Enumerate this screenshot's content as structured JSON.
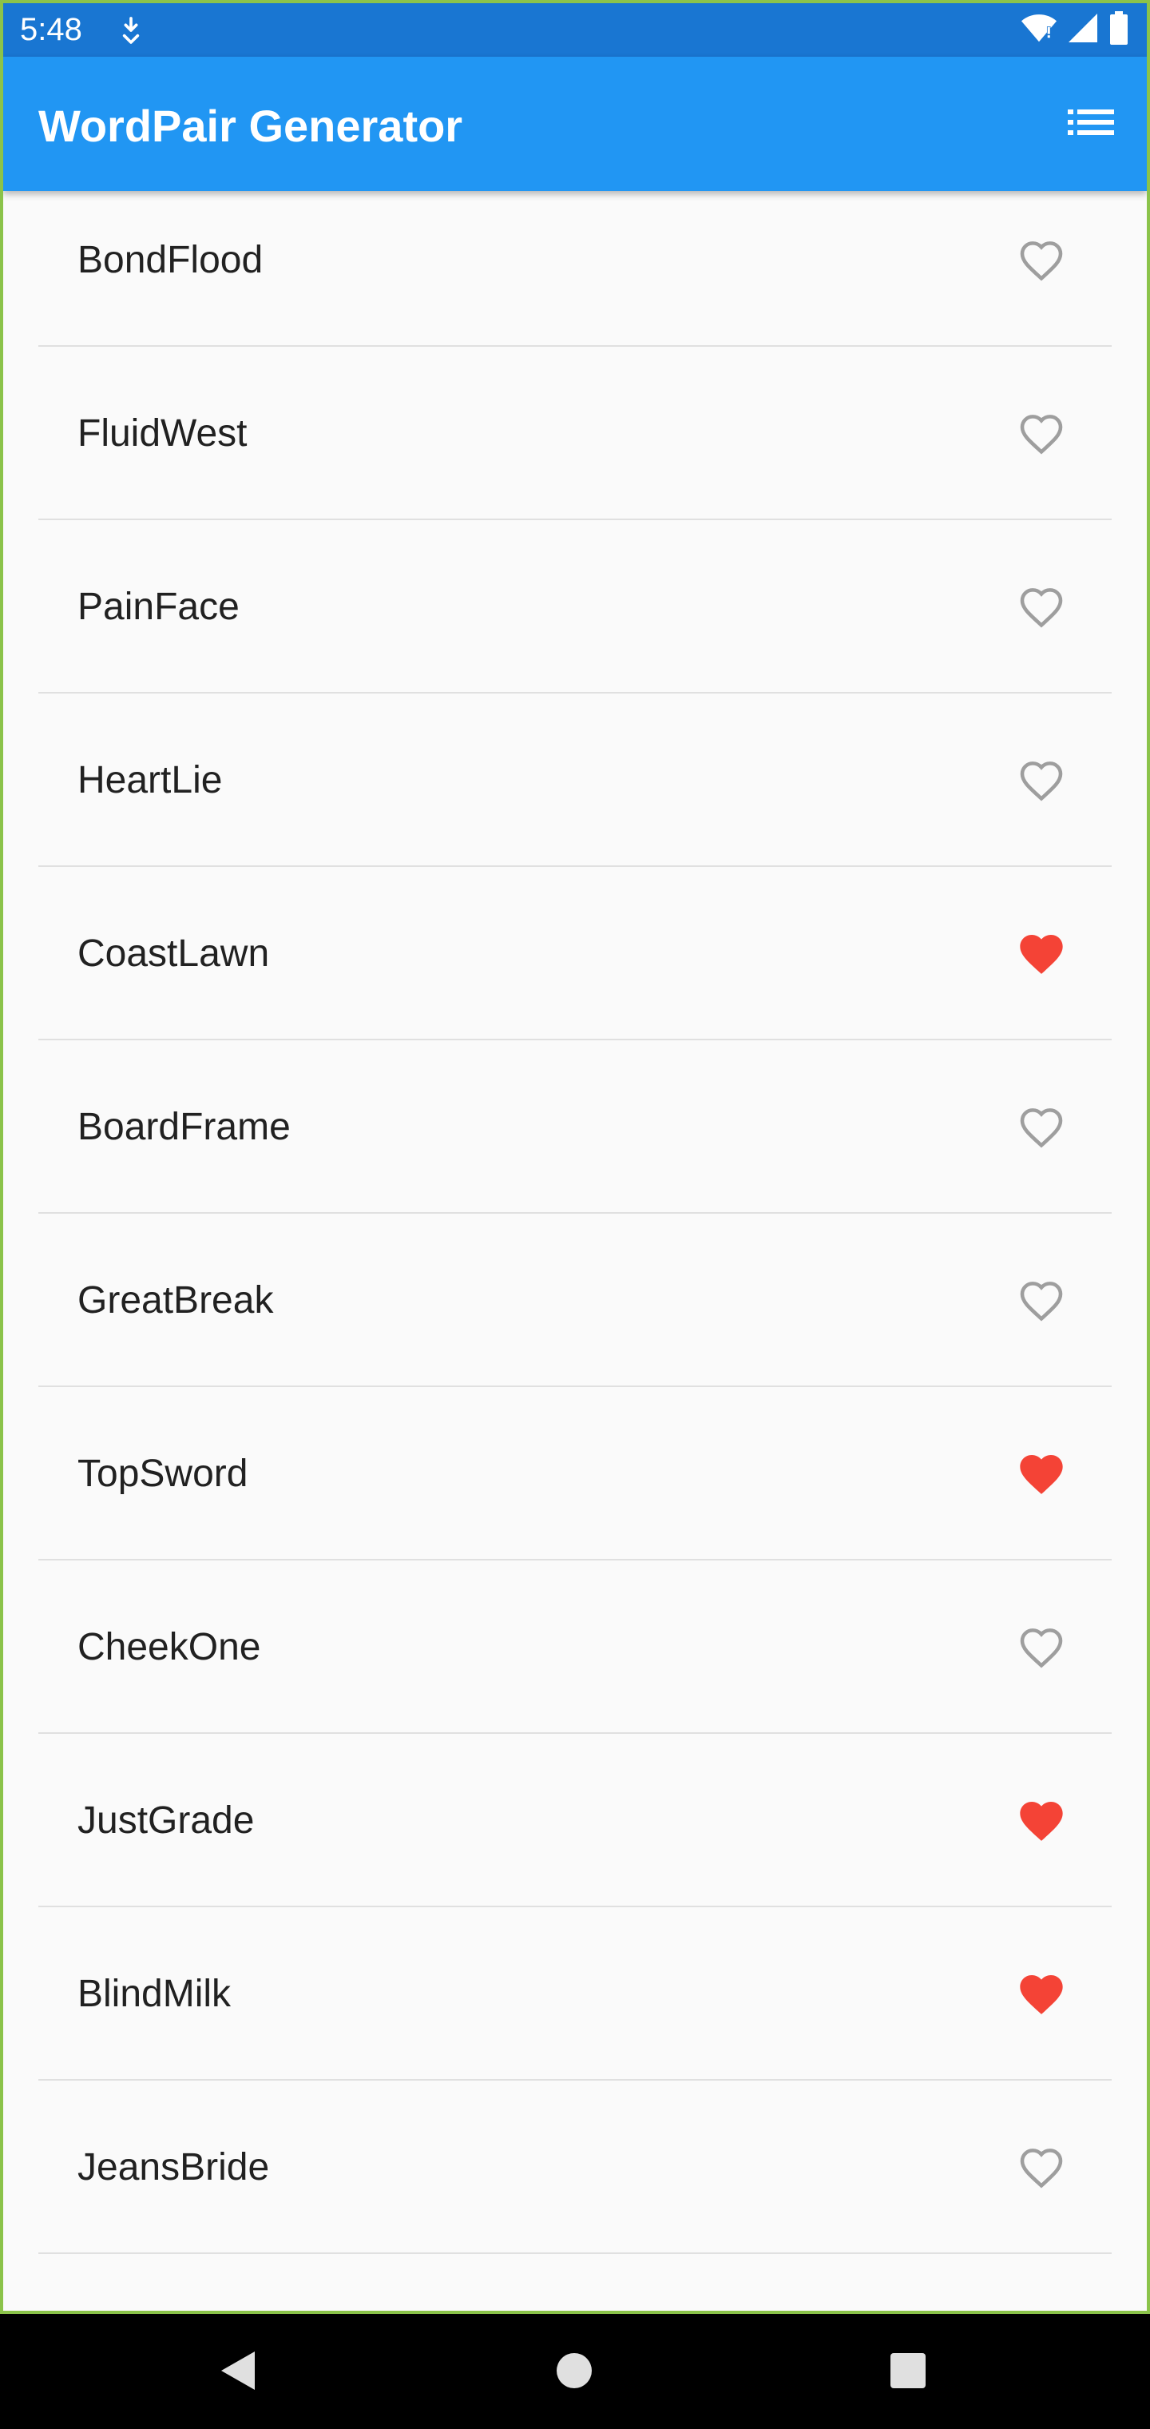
{
  "status_bar": {
    "time": "5:48"
  },
  "app_bar": {
    "title": "WordPair Generator",
    "action_icon": "list-icon"
  },
  "items": [
    {
      "text": "BondFlood",
      "saved": false
    },
    {
      "text": "FluidWest",
      "saved": false
    },
    {
      "text": "PainFace",
      "saved": false
    },
    {
      "text": "HeartLie",
      "saved": false
    },
    {
      "text": "CoastLawn",
      "saved": true
    },
    {
      "text": "BoardFrame",
      "saved": false
    },
    {
      "text": "GreatBreak",
      "saved": false
    },
    {
      "text": "TopSword",
      "saved": true
    },
    {
      "text": "CheekOne",
      "saved": false
    },
    {
      "text": "JustGrade",
      "saved": true
    },
    {
      "text": "BlindMilk",
      "saved": true
    },
    {
      "text": "JeansBride",
      "saved": false
    }
  ],
  "colors": {
    "status_bar": "#1976d2",
    "app_bar": "#2196f3",
    "heart_saved": "#f44336",
    "heart_unsaved": "#9e9e9e"
  },
  "nav_bar": {
    "icons": [
      "back-icon",
      "home-icon",
      "recents-icon"
    ]
  }
}
